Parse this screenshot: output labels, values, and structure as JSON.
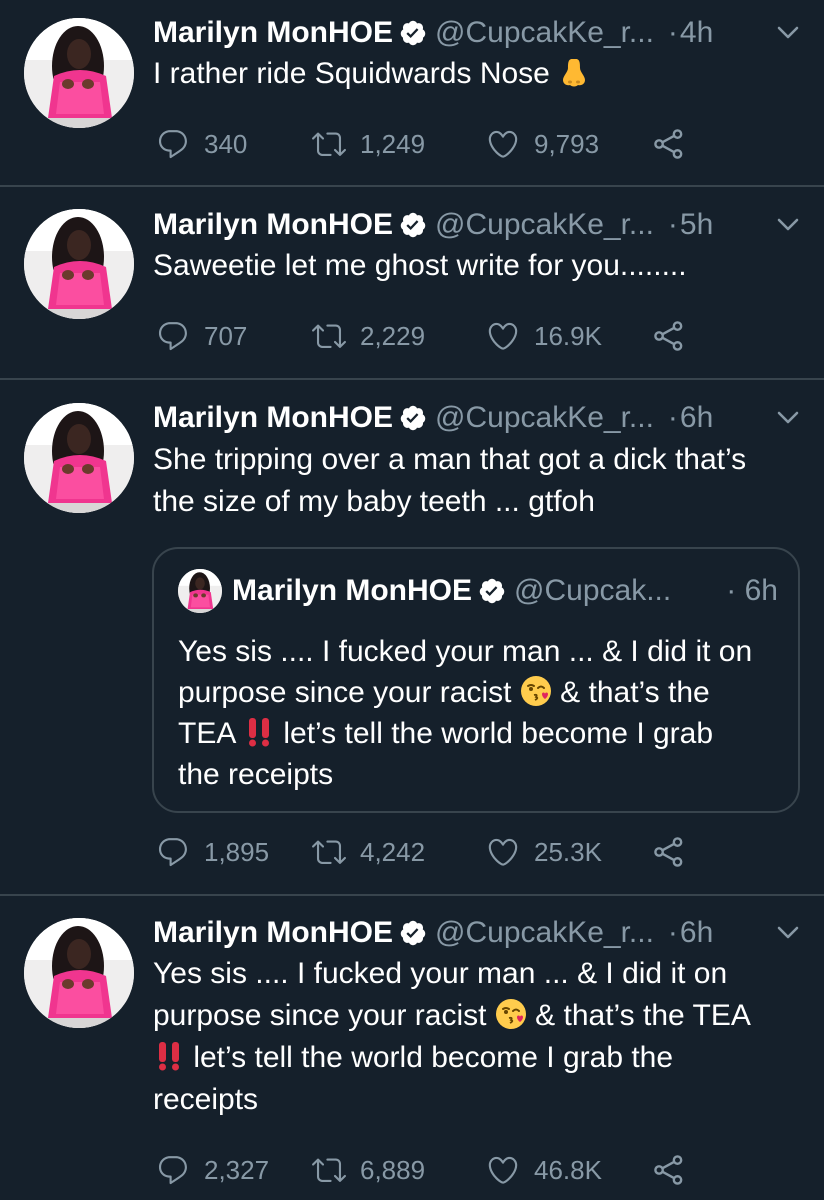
{
  "tweets": [
    {
      "name": "Marilyn MonHOE",
      "handle": "@CupcakKe_r...",
      "dot": "·",
      "time": "4h",
      "text_parts": [
        "I rather ride Squidwards Nose "
      ],
      "emoji": "nose",
      "replies": "340",
      "retweets": "1,249",
      "likes": "9,793"
    },
    {
      "name": "Marilyn MonHOE",
      "handle": "@CupcakKe_r...",
      "dot": "·",
      "time": "5h",
      "text_parts": [
        "Saweetie let me ghost write for you........"
      ],
      "replies": "707",
      "retweets": "2,229",
      "likes": "16.9K"
    },
    {
      "name": "Marilyn MonHOE",
      "handle": "@CupcakKe_r...",
      "dot": "·",
      "time": "6h",
      "text_line1": "She tripping over a man that got a dick that’s",
      "text_line2": "the size of my baby teeth ... gtfoh",
      "replies": "1,895",
      "retweets": "4,242",
      "likes": "25.3K",
      "quote": {
        "name": "Marilyn MonHOE",
        "handle": "@Cupcak...",
        "dot": "·",
        "time": "6h",
        "line1": "Yes sis .... I fucked your man ... & I did it on",
        "line2a": "purpose since your racist ",
        "line2b": " & that’s the",
        "line3a": "TEA ",
        "line3b": " let’s tell the world become I grab",
        "line4": "the receipts"
      }
    },
    {
      "name": "Marilyn MonHOE",
      "handle": "@CupcakKe_r...",
      "dot": "·",
      "time": "6h",
      "line1": "Yes sis .... I fucked your man ... & I did it on",
      "line2a": "purpose since your racist ",
      "line2b": " & that’s the TEA",
      "line3b": " let’s tell the world become I grab the",
      "line4": "receipts",
      "replies": "2,327",
      "retweets": "6,889",
      "likes": "46.8K"
    }
  ],
  "colors": {
    "background": "#15202b",
    "muted_text": "#8899a6",
    "divider": "#38444d",
    "verified_badge": "#ffffff"
  },
  "icons": [
    "reply-icon",
    "retweet-icon",
    "like-icon",
    "share-icon",
    "verified-badge-icon",
    "chevron-down-icon",
    "avatar"
  ]
}
